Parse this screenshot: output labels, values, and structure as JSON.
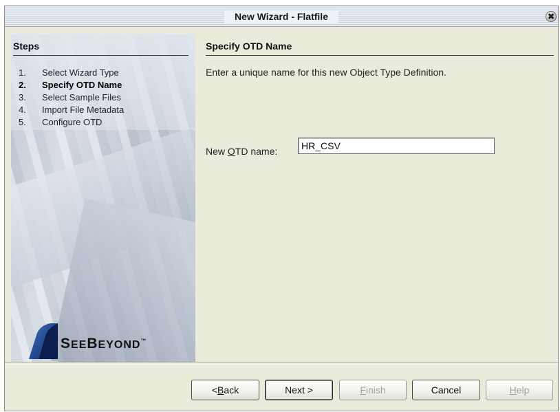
{
  "window": {
    "title": "New Wizard - Flatfile",
    "close_glyph": "✖"
  },
  "steps": {
    "header": "Steps",
    "items": [
      {
        "num": "1.",
        "label": "Select Wizard Type",
        "active": false
      },
      {
        "num": "2.",
        "label": "Specify OTD Name",
        "active": true
      },
      {
        "num": "3.",
        "label": "Select Sample Files",
        "active": false
      },
      {
        "num": "4.",
        "label": "Import File Metadata",
        "active": false
      },
      {
        "num": "5.",
        "label": "Configure OTD",
        "active": false
      }
    ]
  },
  "logo": {
    "text_big_s": "S",
    "text_rest1": "EE",
    "text_big_b": "B",
    "text_rest2": "EYOND",
    "tm": "™"
  },
  "content": {
    "title": "Specify OTD Name",
    "description": "Enter a unique name for this new Object Type Definition.",
    "field_label_pre": "New ",
    "field_label_mnemonic": "O",
    "field_label_post": "TD name:",
    "field_value": "HR_CSV"
  },
  "buttons": {
    "back_pre": "< ",
    "back_mnemonic": "B",
    "back_post": "ack",
    "next": "Next >",
    "finish_mnemonic": "F",
    "finish_post": "inish",
    "cancel": "Cancel",
    "help_mnemonic": "H",
    "help_post": "elp"
  },
  "colors": {
    "dialog_bg": "#ebebdc",
    "disabled_text": "#a0a0a0"
  }
}
